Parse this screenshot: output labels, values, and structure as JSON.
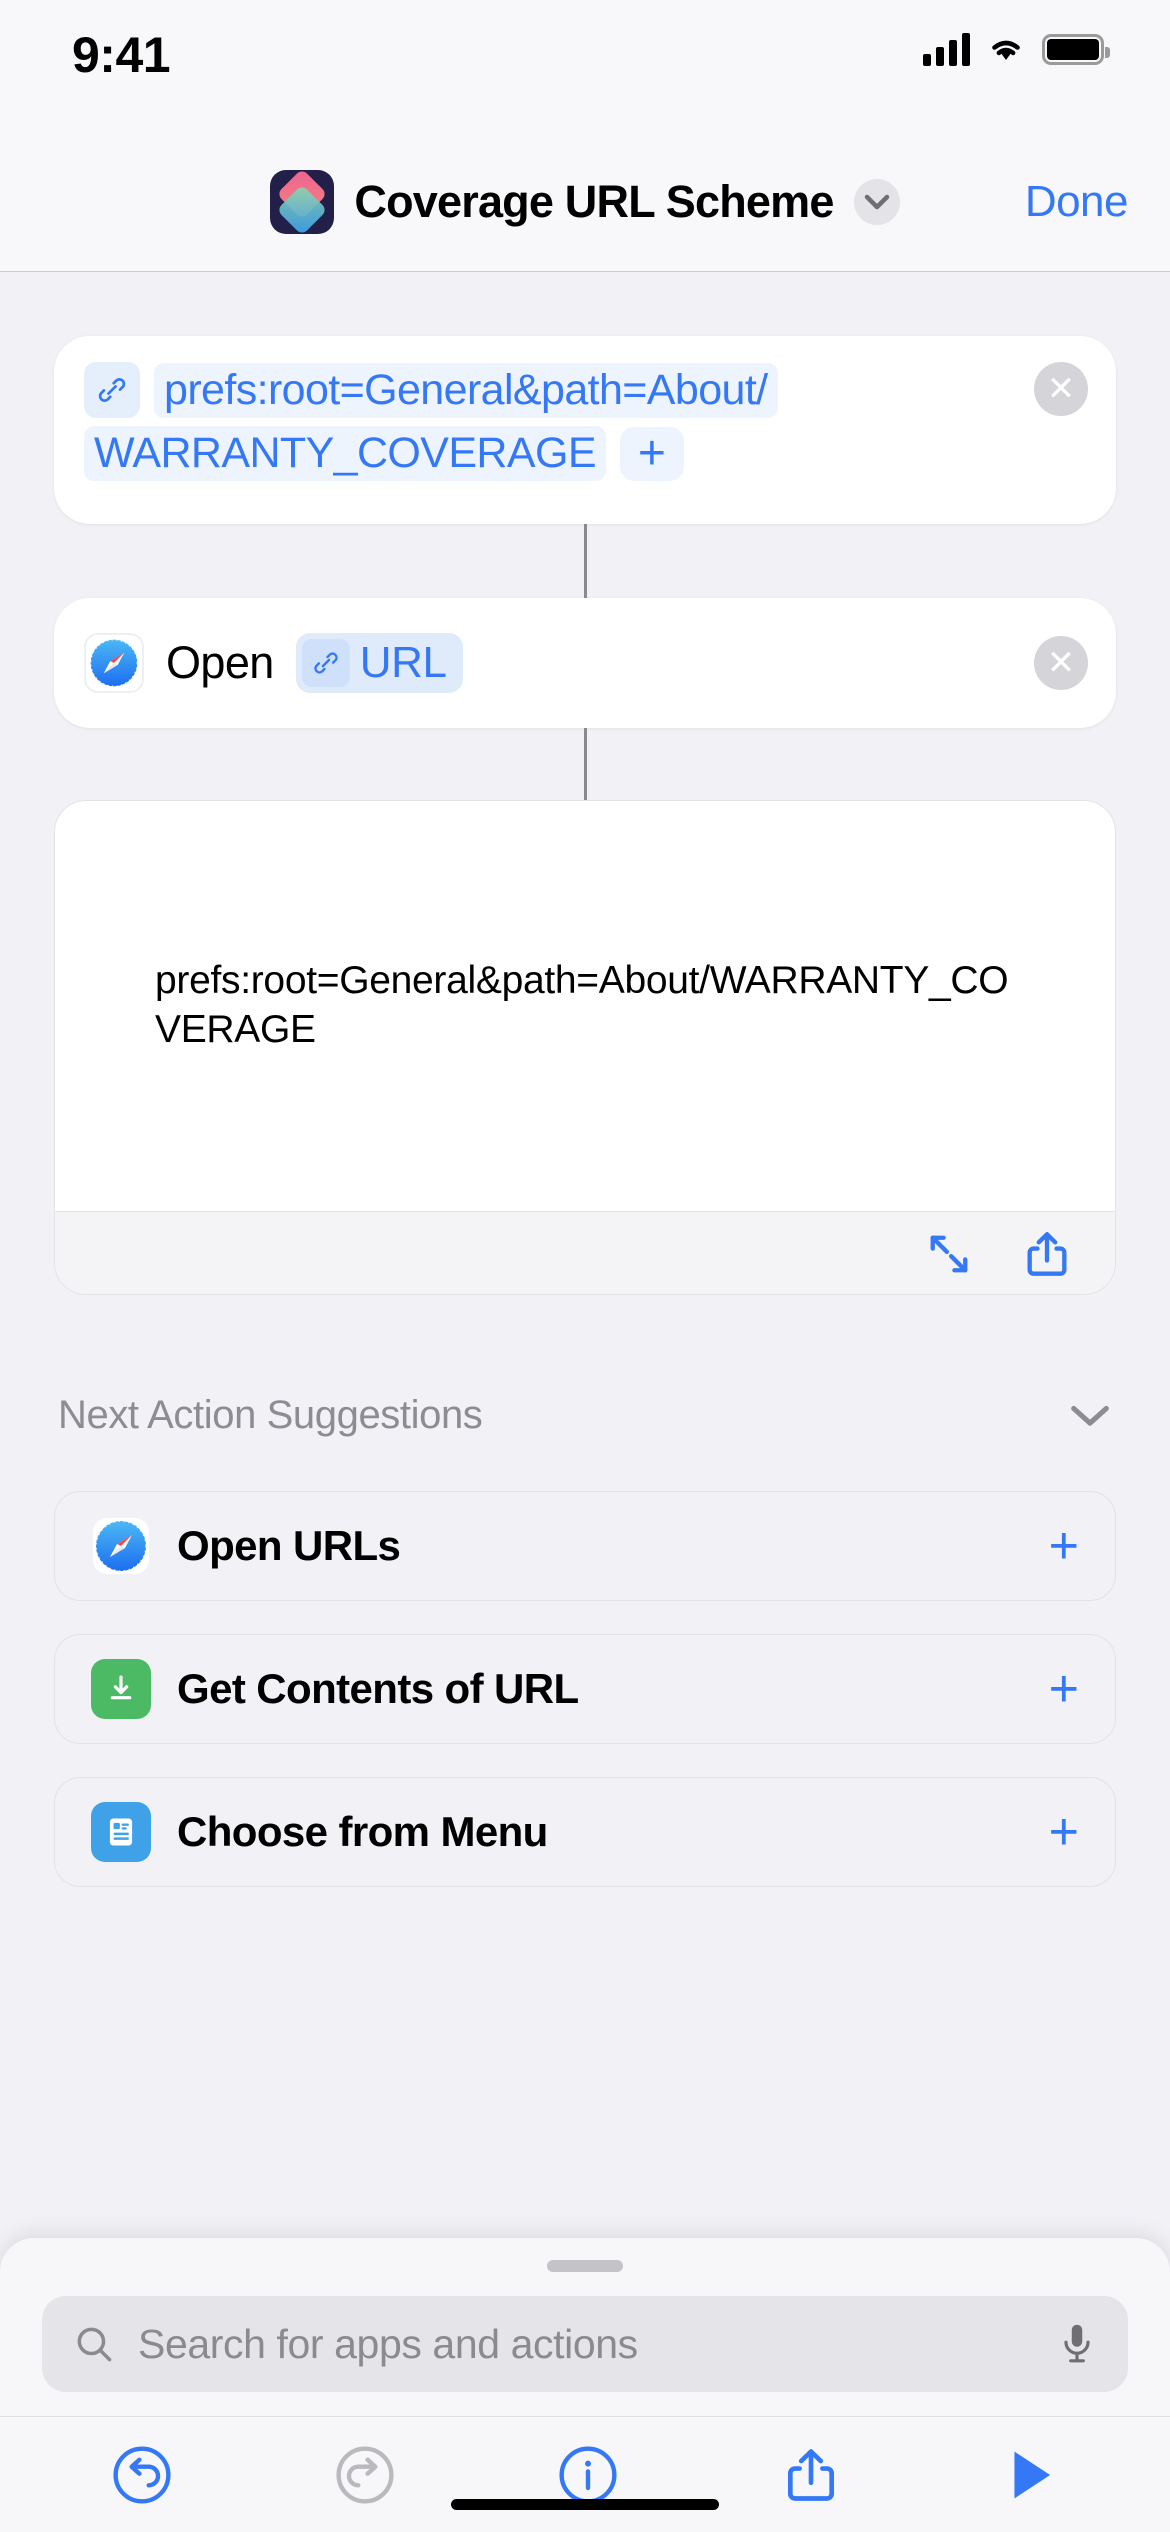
{
  "status_bar": {
    "time": "9:41",
    "cellular_icon": "signal-bars-icon",
    "wifi_icon": "wifi-icon",
    "battery_icon": "battery-icon"
  },
  "nav_bar": {
    "app_icon": "shortcuts-app-icon",
    "title": "Coverage URL Scheme",
    "chevron_icon": "chevron-down-icon",
    "done_label": "Done"
  },
  "actions": {
    "url_action": {
      "link_icon": "link-icon",
      "url_line1": "prefs:root=General&path=About/",
      "url_line2": "WARRANTY_COVERAGE",
      "add_label": "+",
      "close_label": "✕"
    },
    "open_action": {
      "app_icon": "safari-icon",
      "verb": "Open",
      "variable_icon": "link-icon",
      "variable_label": "URL",
      "close_label": "✕"
    },
    "result_preview": {
      "text": "prefs:root=General&path=About/WARRANTY_COVERAGE",
      "expand_icon": "expand-arrows-icon",
      "share_icon": "share-icon"
    }
  },
  "next_action_suggestions": {
    "title": "Next Action Suggestions",
    "collapse_icon": "chevron-down-icon",
    "items": [
      {
        "icon": "safari-icon",
        "label": "Open URLs",
        "add_label": "+"
      },
      {
        "icon": "download-url-icon",
        "label": "Get Contents of URL",
        "add_label": "+"
      },
      {
        "icon": "menu-list-icon",
        "label": "Choose from Menu",
        "add_label": "+"
      }
    ]
  },
  "sheet": {
    "grabber": "sheet-grabber",
    "search": {
      "icon": "search-icon",
      "placeholder": "Search for apps and actions",
      "value": "",
      "mic_icon": "microphone-icon"
    },
    "toolbar": [
      {
        "name": "undo-button",
        "icon": "undo-icon",
        "enabled": true
      },
      {
        "name": "redo-button",
        "icon": "redo-icon",
        "enabled": false
      },
      {
        "name": "info-button",
        "icon": "info-icon",
        "enabled": true
      },
      {
        "name": "share-button",
        "icon": "share-icon",
        "enabled": true
      },
      {
        "name": "run-button",
        "icon": "play-icon",
        "enabled": true
      }
    ]
  },
  "colors": {
    "accent_blue": "#3478f6",
    "disabled_gray": "#b9b9be",
    "page_background": "#f1f1f6",
    "card_background": "#ffffff"
  }
}
